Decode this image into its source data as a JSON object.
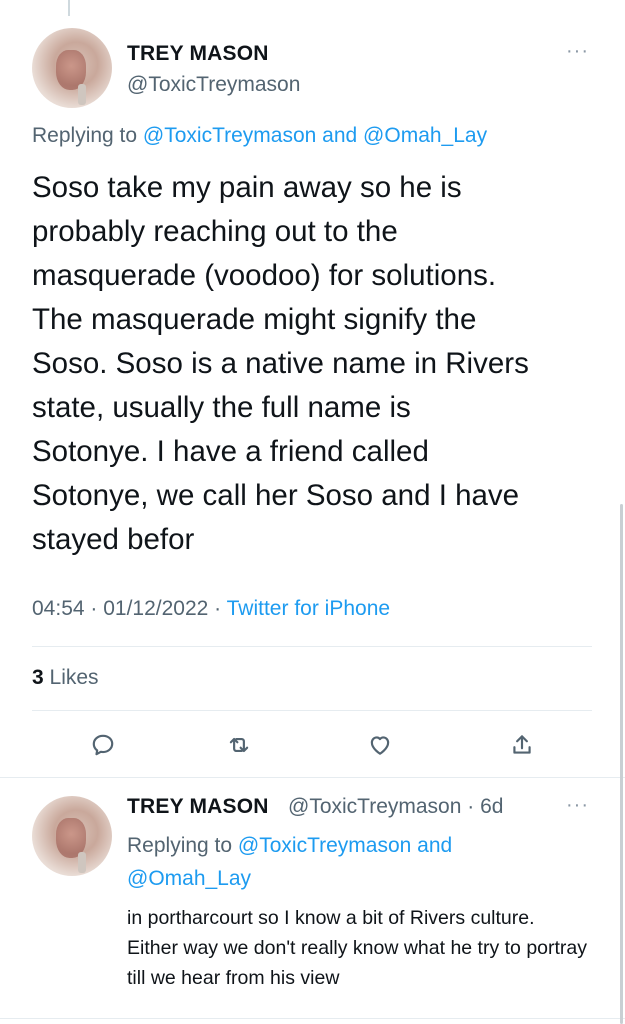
{
  "main_tweet": {
    "author_name": "TREY MASON",
    "author_handle": "@ToxicTreymason",
    "replying_prefix": "Replying to ",
    "replying_to_1": "@ToxicTreymason",
    "replying_and": " and ",
    "replying_to_2": "@Omah_Lay",
    "text": "Soso take my pain away so he is\nprobably reaching out to the\nmasquerade (voodoo) for solutions.\nThe masquerade might signify the\nSoso. Soso is a native name in Rivers\nstate, usually the full name is\nSotonye. I have a friend called\nSotonye, we call her Soso and I have\nstayed befor",
    "time": "04:54",
    "date": "01/12/2022",
    "source": "Twitter for iPhone",
    "likes_count": "3",
    "likes_label": "Likes"
  },
  "reply_tweet": {
    "author_name": "TREY MASON",
    "author_handle": "@ToxicTreymason",
    "age": "6d",
    "replying_prefix": "Replying to ",
    "replying_to_1": "@ToxicTreymason",
    "replying_and": " and",
    "replying_to_2": "@Omah_Lay",
    "text": "in portharcourt so I know a bit of Rivers culture. Either way we don't really know what he try to portray till we hear from his view"
  },
  "icons": {
    "more": "more-horizontal-icon",
    "reply": "reply-icon",
    "retweet": "retweet-icon",
    "like": "heart-icon",
    "share": "share-icon"
  },
  "colors": {
    "text": "#0f1419",
    "secondary": "#536471",
    "link": "#1d9bf0",
    "divider": "#e6ecf0"
  }
}
